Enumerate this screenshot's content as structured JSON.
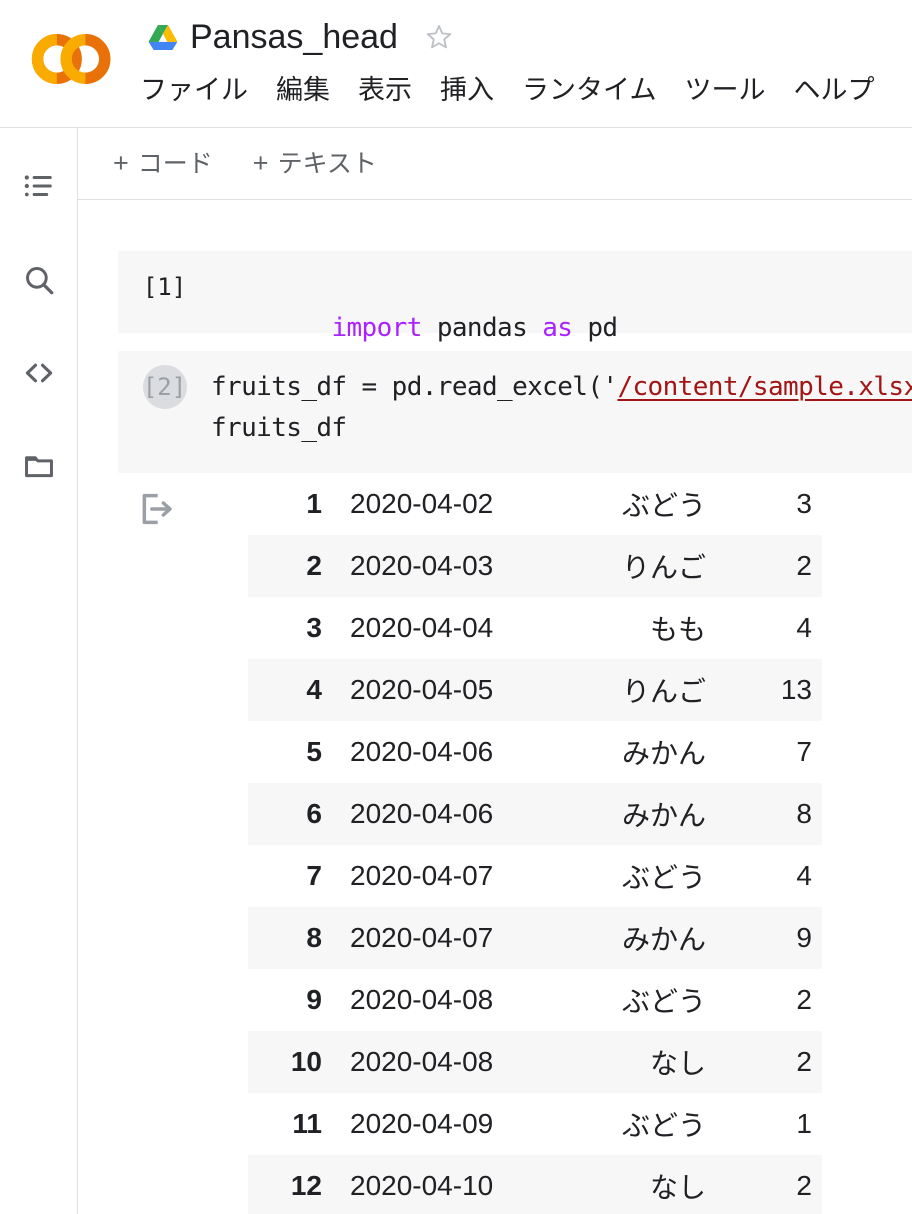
{
  "header": {
    "logo_name": "colab-logo",
    "drive_icon": "google-drive-icon",
    "title": "Pansas_head",
    "star_icon": "star-outline-icon",
    "menu": [
      {
        "label": "ファイル"
      },
      {
        "label": "編集"
      },
      {
        "label": "表示"
      },
      {
        "label": "挿入"
      },
      {
        "label": "ランタイム"
      },
      {
        "label": "ツール"
      },
      {
        "label": "ヘルプ"
      }
    ]
  },
  "rail": {
    "items": [
      {
        "icon": "table-of-contents-icon",
        "name": "sidebar-item-toc"
      },
      {
        "icon": "search-icon",
        "name": "sidebar-item-search"
      },
      {
        "icon": "code-snippets-icon",
        "name": "sidebar-item-snippets"
      },
      {
        "icon": "folder-icon",
        "name": "sidebar-item-files"
      }
    ]
  },
  "toolbar": {
    "add_code_plus": "+",
    "add_code_label": "コード",
    "add_text_plus": "+",
    "add_text_label": "テキスト"
  },
  "cells": [
    {
      "exec_count": "[1]",
      "hovered": false,
      "lines": [
        {
          "parts": [
            {
              "t": "import",
              "c": "kw"
            },
            {
              "t": " pandas ",
              "c": ""
            },
            {
              "t": "as",
              "c": "kw"
            },
            {
              "t": " pd",
              "c": ""
            }
          ]
        }
      ]
    },
    {
      "exec_count": "[2]",
      "hovered": true,
      "lines": [
        {
          "parts": [
            {
              "t": "fruits_df = pd.read_excel('",
              "c": ""
            },
            {
              "t": "/content/sample.xlsx",
              "c": "str"
            },
            {
              "t": "')",
              "c": ""
            }
          ]
        },
        {
          "parts": [
            {
              "t": "fruits_df",
              "c": ""
            }
          ]
        }
      ]
    }
  ],
  "output": {
    "icon": "output-arrow-icon",
    "table": {
      "rows": [
        {
          "index": "1",
          "date": "2020-04-02",
          "fruit": "ぶどう",
          "count": "3"
        },
        {
          "index": "2",
          "date": "2020-04-03",
          "fruit": "りんご",
          "count": "2"
        },
        {
          "index": "3",
          "date": "2020-04-04",
          "fruit": "もも",
          "count": "4"
        },
        {
          "index": "4",
          "date": "2020-04-05",
          "fruit": "りんご",
          "count": "13"
        },
        {
          "index": "5",
          "date": "2020-04-06",
          "fruit": "みかん",
          "count": "7"
        },
        {
          "index": "6",
          "date": "2020-04-06",
          "fruit": "みかん",
          "count": "8"
        },
        {
          "index": "7",
          "date": "2020-04-07",
          "fruit": "ぶどう",
          "count": "4"
        },
        {
          "index": "8",
          "date": "2020-04-07",
          "fruit": "みかん",
          "count": "9"
        },
        {
          "index": "9",
          "date": "2020-04-08",
          "fruit": "ぶどう",
          "count": "2"
        },
        {
          "index": "10",
          "date": "2020-04-08",
          "fruit": "なし",
          "count": "2"
        },
        {
          "index": "11",
          "date": "2020-04-09",
          "fruit": "ぶどう",
          "count": "1"
        },
        {
          "index": "12",
          "date": "2020-04-10",
          "fruit": "なし",
          "count": "2"
        }
      ]
    }
  },
  "colors": {
    "accent_orange": "#f9ab00",
    "accent_orange_dark": "#e8710a",
    "keyword_purple": "#aa22ff",
    "string_red": "#a31515",
    "cell_bg": "#f7f7f7",
    "row_stripe": "#f7f7f7",
    "border": "#e0e0e0",
    "text": "#202124",
    "muted": "#5f6368"
  }
}
